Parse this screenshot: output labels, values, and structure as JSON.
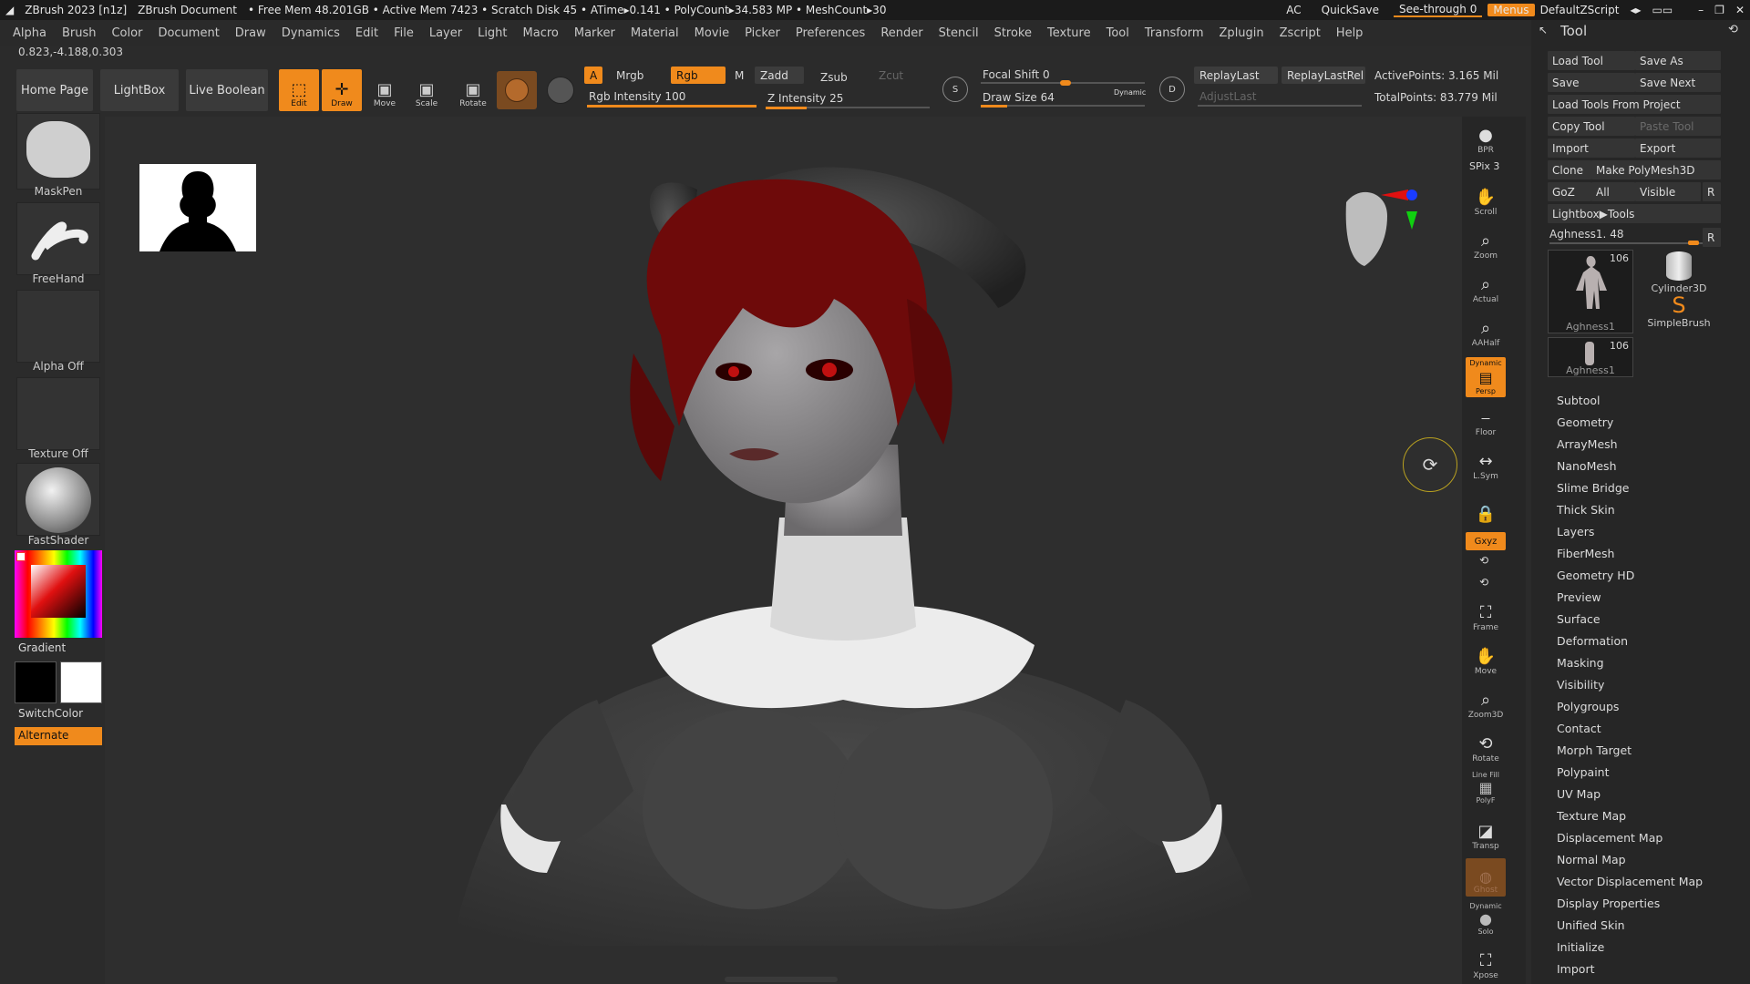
{
  "titlebar": {
    "app": "ZBrush 2023 [n1z]",
    "doc": "ZBrush Document",
    "stats": "• Free Mem 48.201GB • Active Mem 7423 • Scratch Disk 45 • ATime▸0.141 • PolyCount▸34.583 MP • MeshCount▸30",
    "ac": "AC",
    "quicksave": "QuickSave",
    "see_through": "See-through",
    "see_through_value": "0",
    "menus": "Menus",
    "script": "DefaultZScript"
  },
  "menubar": [
    "Alpha",
    "Brush",
    "Color",
    "Document",
    "Draw",
    "Dynamics",
    "Edit",
    "File",
    "Layer",
    "Light",
    "Macro",
    "Marker",
    "Material",
    "Movie",
    "Picker",
    "Preferences",
    "Render",
    "Stencil",
    "Stroke",
    "Texture",
    "Tool",
    "Transform",
    "Zplugin",
    "Zscript",
    "Help"
  ],
  "coords": "0.823,-4.188,0.303",
  "toolbar": {
    "home": "Home Page",
    "lightbox": "LightBox",
    "live_boolean": "Live Boolean",
    "edit": "Edit",
    "draw": "Draw",
    "move": "Move",
    "scale": "Scale",
    "rotate": "Rotate",
    "a": "A",
    "mrgb": "Mrgb",
    "rgb": "Rgb",
    "m": "M",
    "zadd": "Zadd",
    "zsub": "Zsub",
    "zcut": "Zcut",
    "rgb_intensity": "Rgb Intensity 100",
    "z_intensity": "Z Intensity 25",
    "focal_shift": "Focal Shift 0",
    "draw_size": "Draw Size 64",
    "dynamic": "Dynamic",
    "replay_last": "ReplayLast",
    "replay_last_rel": "ReplayLastRel",
    "adjust_last": "AdjustLast",
    "active_points": "ActivePoints: 3.165 Mil",
    "total_points": "TotalPoints: 83.779 Mil",
    "rgb_intensity_level": 1.0,
    "z_intensity_level": 0.25,
    "draw_size_level": 0.16
  },
  "leftshelf": {
    "maskpen": "MaskPen",
    "freehand": "FreeHand",
    "alpha_off": "Alpha Off",
    "texture_off": "Texture Off",
    "fastshader": "FastShader",
    "gradient": "Gradient",
    "switchcolor": "SwitchColor",
    "alternate": "Alternate"
  },
  "rightshelf": {
    "bpr": "BPR",
    "spix": "SPix 3",
    "scroll": "Scroll",
    "zoom": "Zoom",
    "actual": "Actual",
    "aahalf": "AAHalf",
    "dynamic": "Dynamic",
    "persp": "Persp",
    "floor": "Floor",
    "lsym": "L.Sym",
    "xyz": "Gxyz",
    "frame": "Frame",
    "move": "Move",
    "zoom3d": "Zoom3D",
    "rotate": "Rotate",
    "linefill": "Line Fill",
    "polyf": "PolyF",
    "transp": "Transp",
    "ghost": "Ghost",
    "dynamic2": "Dynamic",
    "solo": "Solo",
    "xpose": "Xpose"
  },
  "toolpanel": {
    "title": "Tool",
    "load_tool": "Load Tool",
    "save_as": "Save As",
    "save": "Save",
    "save_next": "Save Next",
    "load_from_project": "Load Tools From Project",
    "copy_tool": "Copy Tool",
    "paste_tool": "Paste Tool",
    "import": "Import",
    "export": "Export",
    "clone": "Clone",
    "make_polymesh": "Make PolyMesh3D",
    "goz": "GoZ",
    "all": "All",
    "visible": "Visible",
    "r": "R",
    "lightbox_tools": "Lightbox▶Tools",
    "current_tool": "Aghness1. 48",
    "thumb1_count": "106",
    "thumb1_name": "Aghness1",
    "thumb2_name": "Cylinder3D",
    "thumb3_name": "SimpleBrush",
    "thumb4_count": "106",
    "thumb4_name": "Aghness1",
    "menus": [
      "Subtool",
      "Geometry",
      "ArrayMesh",
      "NanoMesh",
      "Slime Bridge",
      "Thick Skin",
      "Layers",
      "FiberMesh",
      "Geometry HD",
      "Preview",
      "Surface",
      "Deformation",
      "Masking",
      "Visibility",
      "Polygroups",
      "Contact",
      "Morph Target",
      "Polypaint",
      "UV Map",
      "Texture Map",
      "Displacement Map",
      "Normal Map",
      "Vector Displacement Map",
      "Display Properties",
      "Unified Skin",
      "Initialize",
      "Import"
    ]
  },
  "colors": {
    "accent": "#f08a1c",
    "hair": "#7a0c0c",
    "skin": "#8c8a8c"
  }
}
